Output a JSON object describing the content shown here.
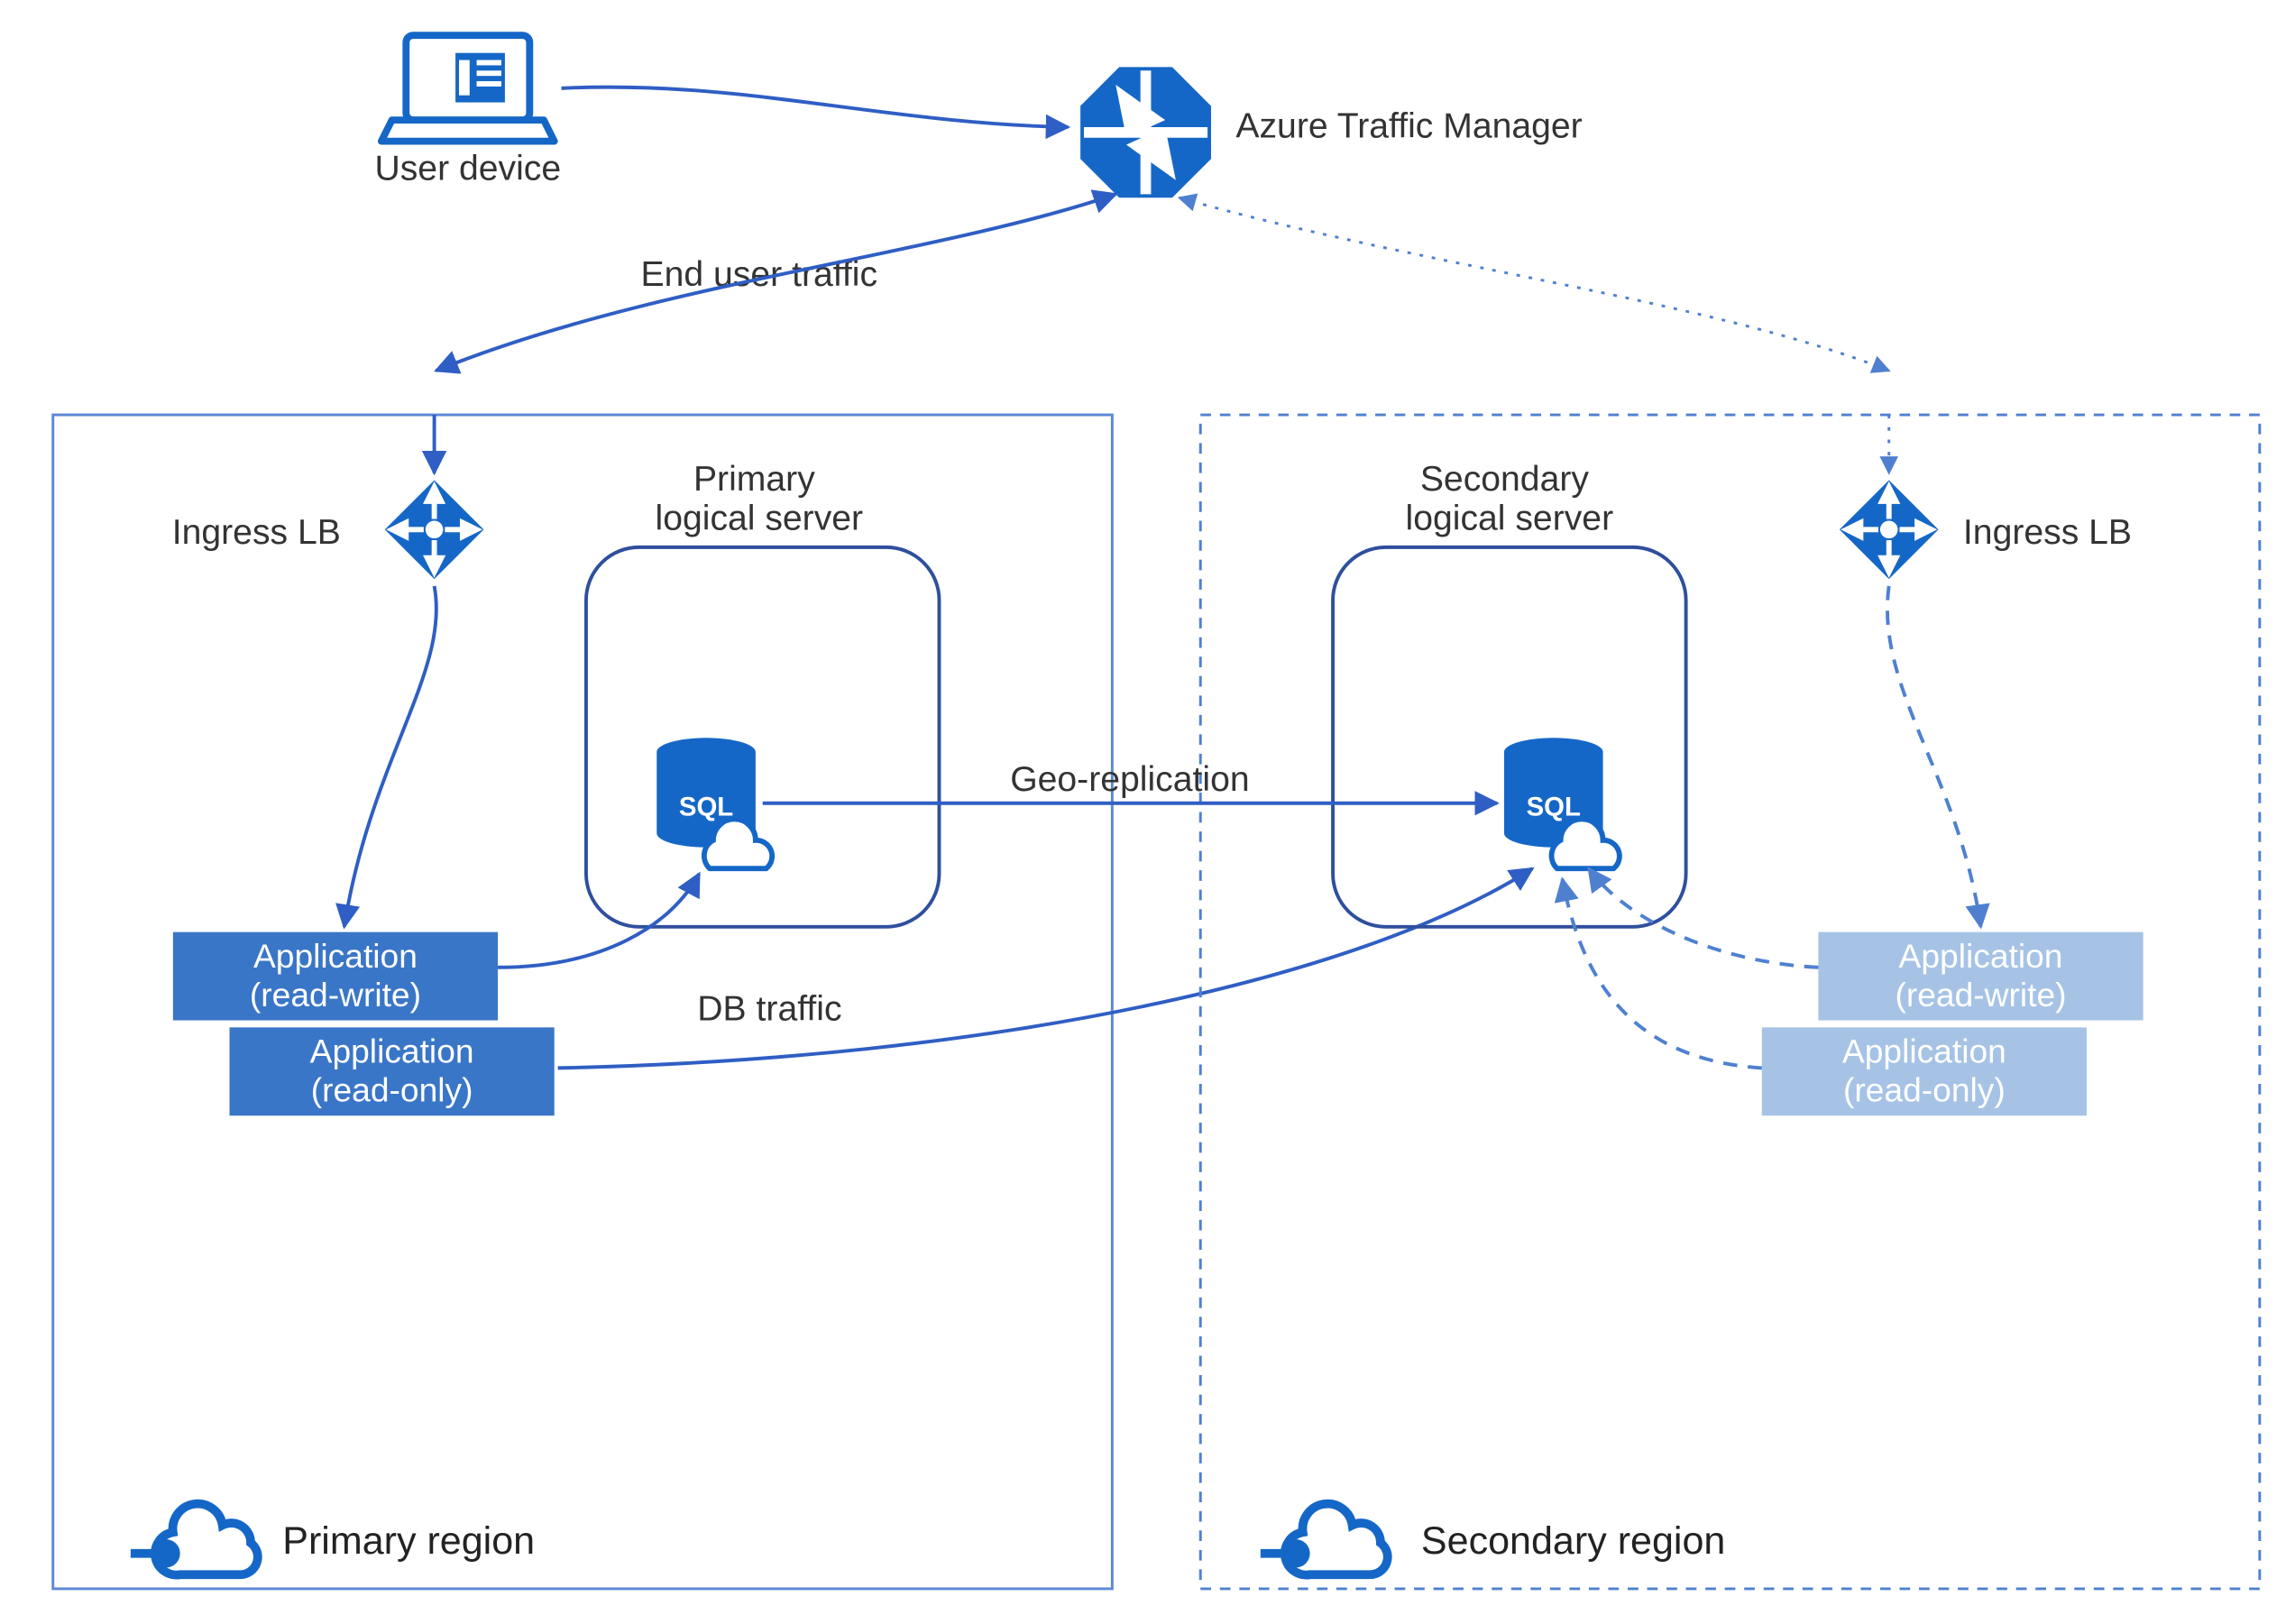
{
  "top": {
    "user_device": "User device",
    "traffic_manager": "Azure Traffic Manager",
    "end_user_traffic": "End user traffic"
  },
  "primary": {
    "region_label": "Primary region",
    "ingress_lb": "Ingress LB",
    "logical_server": "Primary\nlogical server",
    "app_rw_line1": "Application",
    "app_rw_line2": "(read-write)",
    "app_ro_line1": "Application",
    "app_ro_line2": "(read-only)",
    "db_traffic": "DB traffic"
  },
  "secondary": {
    "region_label": "Secondary region",
    "ingress_lb": "Ingress LB",
    "logical_server": "Secondary\nlogical server",
    "app_rw_line1": "Application",
    "app_rw_line2": "(read-write)",
    "app_ro_line1": "Application",
    "app_ro_line2": "(read-only)"
  },
  "links": {
    "geo_replication": "Geo-replication"
  },
  "colors": {
    "azure_blue": "#1567c7",
    "light_border": "#5c89d6",
    "dashed_border": "#4f80d0",
    "app_active": "#3a76c7",
    "app_standby": "#a6c3e6"
  }
}
